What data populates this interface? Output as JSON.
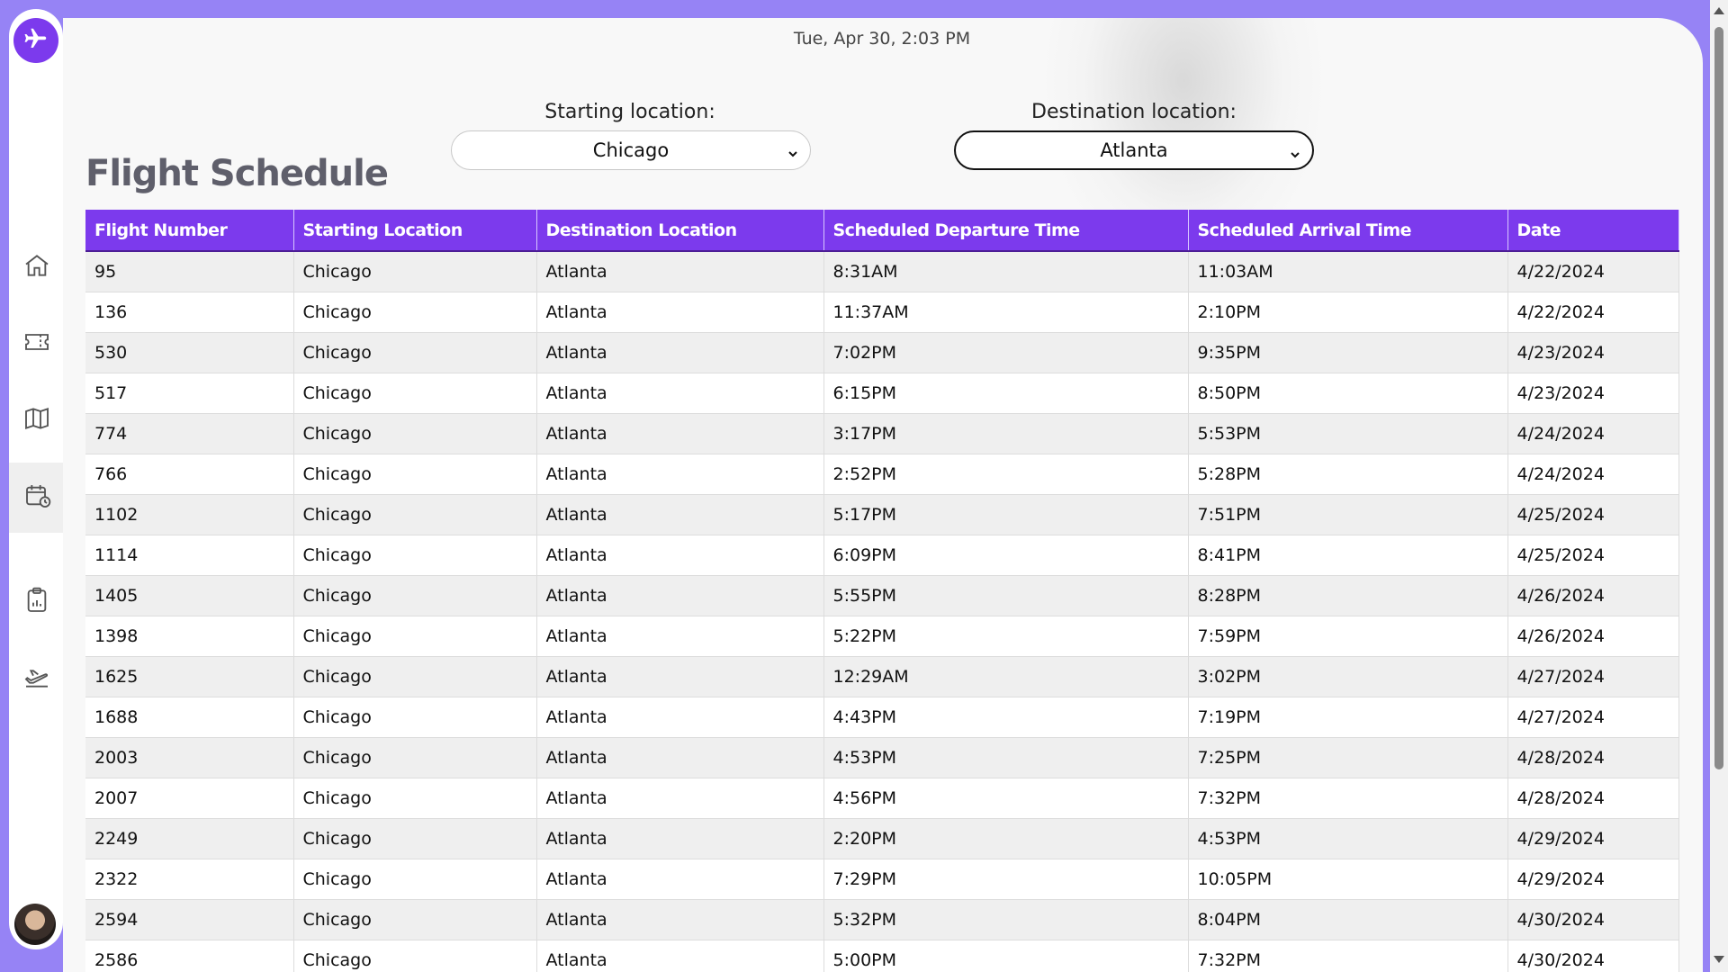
{
  "header": {
    "datetime": "Tue, Apr 30, 2:03 PM",
    "page_title": "Flight Schedule"
  },
  "filters": {
    "start_label": "Starting location:",
    "start_value": "Chicago",
    "dest_label": "Destination location:",
    "dest_value": "Atlanta"
  },
  "sidebar": {
    "logo_icon": "airplane-icon",
    "items": [
      {
        "icon": "home-icon",
        "active": false
      },
      {
        "icon": "ticket-icon",
        "active": false
      },
      {
        "icon": "map-icon",
        "active": false
      },
      {
        "icon": "calendar-clock-icon",
        "active": true
      },
      {
        "icon": "clipboard-chart-icon",
        "active": false
      },
      {
        "icon": "airplane-takeoff-icon",
        "active": false
      }
    ]
  },
  "colors": {
    "accent": "#7c3aed",
    "page_background": "#9683f5"
  },
  "table": {
    "columns": [
      "Flight Number",
      "Starting Location",
      "Destination Location",
      "Scheduled Departure Time",
      "Scheduled Arrival Time",
      "Date"
    ],
    "rows": [
      [
        "95",
        "Chicago",
        "Atlanta",
        "8:31AM",
        "11:03AM",
        "4/22/2024"
      ],
      [
        "136",
        "Chicago",
        "Atlanta",
        "11:37AM",
        "2:10PM",
        "4/22/2024"
      ],
      [
        "530",
        "Chicago",
        "Atlanta",
        "7:02PM",
        "9:35PM",
        "4/23/2024"
      ],
      [
        "517",
        "Chicago",
        "Atlanta",
        "6:15PM",
        "8:50PM",
        "4/23/2024"
      ],
      [
        "774",
        "Chicago",
        "Atlanta",
        "3:17PM",
        "5:53PM",
        "4/24/2024"
      ],
      [
        "766",
        "Chicago",
        "Atlanta",
        "2:52PM",
        "5:28PM",
        "4/24/2024"
      ],
      [
        "1102",
        "Chicago",
        "Atlanta",
        "5:17PM",
        "7:51PM",
        "4/25/2024"
      ],
      [
        "1114",
        "Chicago",
        "Atlanta",
        "6:09PM",
        "8:41PM",
        "4/25/2024"
      ],
      [
        "1405",
        "Chicago",
        "Atlanta",
        "5:55PM",
        "8:28PM",
        "4/26/2024"
      ],
      [
        "1398",
        "Chicago",
        "Atlanta",
        "5:22PM",
        "7:59PM",
        "4/26/2024"
      ],
      [
        "1625",
        "Chicago",
        "Atlanta",
        "12:29AM",
        "3:02PM",
        "4/27/2024"
      ],
      [
        "1688",
        "Chicago",
        "Atlanta",
        "4:43PM",
        "7:19PM",
        "4/27/2024"
      ],
      [
        "2003",
        "Chicago",
        "Atlanta",
        "4:53PM",
        "7:25PM",
        "4/28/2024"
      ],
      [
        "2007",
        "Chicago",
        "Atlanta",
        "4:56PM",
        "7:32PM",
        "4/28/2024"
      ],
      [
        "2249",
        "Chicago",
        "Atlanta",
        "2:20PM",
        "4:53PM",
        "4/29/2024"
      ],
      [
        "2322",
        "Chicago",
        "Atlanta",
        "7:29PM",
        "10:05PM",
        "4/29/2024"
      ],
      [
        "2594",
        "Chicago",
        "Atlanta",
        "5:32PM",
        "8:04PM",
        "4/30/2024"
      ],
      [
        "2586",
        "Chicago",
        "Atlanta",
        "5:00PM",
        "7:32PM",
        "4/30/2024"
      ]
    ]
  }
}
